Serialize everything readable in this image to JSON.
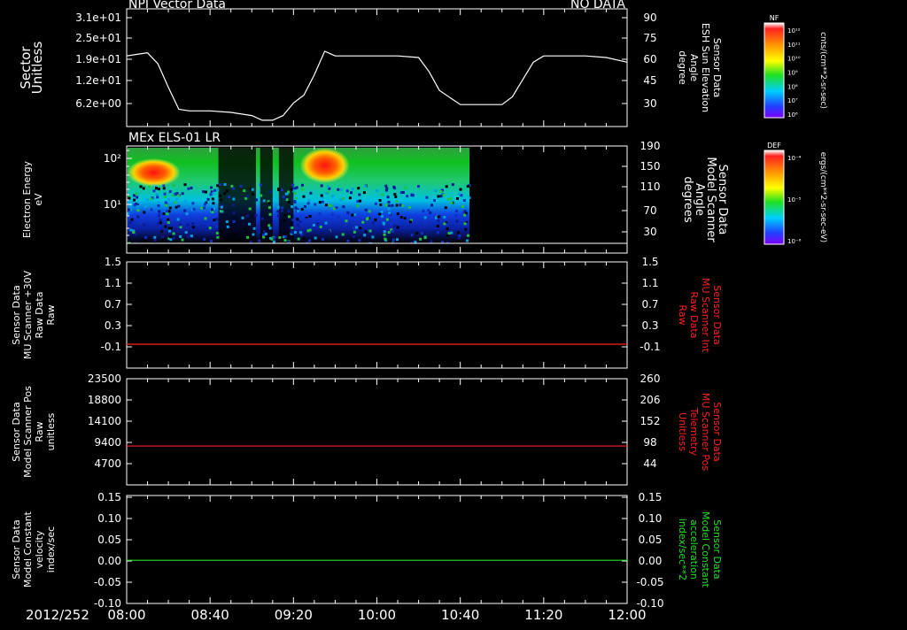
{
  "colors": {
    "white": "#ffffff",
    "red": "#ff2020",
    "green": "#20e020",
    "background": "#000000"
  },
  "x_axis": {
    "date_label": "2012/252",
    "ticks": [
      "08:00",
      "08:40",
      "09:20",
      "10:00",
      "10:40",
      "11:20",
      "12:00"
    ]
  },
  "colorbars": [
    {
      "name": "NF",
      "label": "cnts/(cm**2-sr-sec)",
      "ticks": [
        "10¹²",
        "10¹¹",
        "10¹⁰",
        "10⁹",
        "10⁸",
        "10⁷",
        "10⁶"
      ]
    },
    {
      "name": "DEF",
      "label": "ergs/(cm**2-sr-sec-eV)",
      "ticks": [
        "10⁻⁴",
        "10⁻⁵",
        "10⁻⁶"
      ]
    }
  ],
  "chart_data": [
    {
      "type": "line",
      "title": "NPI Vector Data",
      "status": "NO DATA",
      "ylabel": [
        "Sector",
        "Unitless"
      ],
      "left_ticks": [
        "3.1e+01",
        "2.5e+01",
        "1.9e+01",
        "1.2e+01",
        "6.2e+00"
      ],
      "right_ticks": [
        "90",
        "75",
        "60",
        "45",
        "30"
      ],
      "right_label": [
        "Sensor Data",
        "ESH Sun Elevation",
        "Angle",
        "degree"
      ],
      "right_ylim": [
        15,
        90
      ],
      "series": [
        {
          "x": [
            "08:00",
            "08:05",
            "08:10",
            "08:15",
            "08:20",
            "08:25",
            "08:30",
            "08:40",
            "08:50",
            "09:00",
            "09:05",
            "09:10",
            "09:15",
            "09:20",
            "09:25",
            "09:30",
            "09:35",
            "09:40",
            "09:45",
            "09:50",
            "10:00",
            "10:10",
            "10:20",
            "10:25",
            "10:30",
            "10:40",
            "10:50",
            "10:55",
            "11:00",
            "11:05",
            "11:10",
            "11:15",
            "11:20",
            "11:30",
            "11:40",
            "11:50",
            "12:00"
          ],
          "values": [
            60,
            61,
            62,
            55,
            40,
            26,
            25,
            25,
            24,
            22,
            19,
            19,
            22,
            30,
            35,
            48,
            63,
            60,
            60,
            60,
            60,
            60,
            59,
            50,
            38,
            29,
            29,
            29,
            29,
            34,
            45,
            56,
            60,
            60,
            60,
            59,
            56
          ]
        }
      ]
    },
    {
      "type": "heatmap",
      "title": "MEx ELS-01 LR",
      "ylabel": [
        "Electron Energy",
        "eV"
      ],
      "left_ticks": [
        "10²",
        "10¹"
      ],
      "right_ticks": [
        "190",
        "150",
        "110",
        "70",
        "30"
      ],
      "right_label": [
        "Sensor Data",
        "Model Scanner",
        "Angle",
        "degrees"
      ],
      "data_end": "10:44",
      "series": [
        {
          "x": [
            "08:00",
            "08:44",
            "09:20",
            "10:44"
          ],
          "values": [
            1,
            1,
            1,
            1
          ]
        }
      ]
    },
    {
      "type": "line",
      "ylabel": [
        "Sensor Data",
        "MU Scanner +30V",
        "Raw Data",
        "Raw"
      ],
      "left_ticks": [
        "1.5",
        "1.1",
        "0.7",
        "0.3",
        "-0.1"
      ],
      "right_ticks": [
        "1.5",
        "1.1",
        "0.7",
        "0.3",
        "-0.1"
      ],
      "right_label": [
        "Sensor Data",
        "MU Scanner Int",
        "Raw Data",
        "Raw"
      ],
      "ylim": [
        -0.5,
        1.5
      ],
      "series": [
        {
          "x": [
            "08:00",
            "12:00"
          ],
          "values": [
            -0.05,
            -0.05
          ],
          "color": "#ff2020"
        }
      ]
    },
    {
      "type": "line",
      "ylabel": [
        "Sensor Data",
        "Model Scanner Pos",
        "Raw",
        "unitless"
      ],
      "left_ticks": [
        "23500",
        "18800",
        "14100",
        "9400",
        "4700"
      ],
      "right_ticks": [
        "260",
        "206",
        "152",
        "98",
        "44"
      ],
      "right_label": [
        "Sensor Data",
        "MU Scanner Pos",
        "Telemetry",
        "Unitless"
      ],
      "ylim": [
        0,
        23500
      ],
      "series": [
        {
          "x": [
            "08:00",
            "12:00"
          ],
          "values": [
            8600,
            8600
          ],
          "color": "#ff2020"
        }
      ]
    },
    {
      "type": "line",
      "ylabel": [
        "Sensor Data",
        "Model Constant",
        "velocity",
        "index/sec"
      ],
      "left_ticks": [
        "0.15",
        "0.10",
        "0.05",
        "0.00",
        "-0.05",
        "-0.10"
      ],
      "right_ticks": [
        "0.15",
        "0.10",
        "0.05",
        "0.00",
        "-0.05",
        "-0.10"
      ],
      "right_label": [
        "Sensor Data",
        "Model Constant",
        "acceleration",
        "index/sec**2"
      ],
      "ylim": [
        -0.1,
        0.15
      ],
      "series": [
        {
          "x": [
            "08:00",
            "12:00"
          ],
          "values": [
            0.0,
            0.0
          ],
          "color": "#20e020"
        }
      ]
    }
  ]
}
